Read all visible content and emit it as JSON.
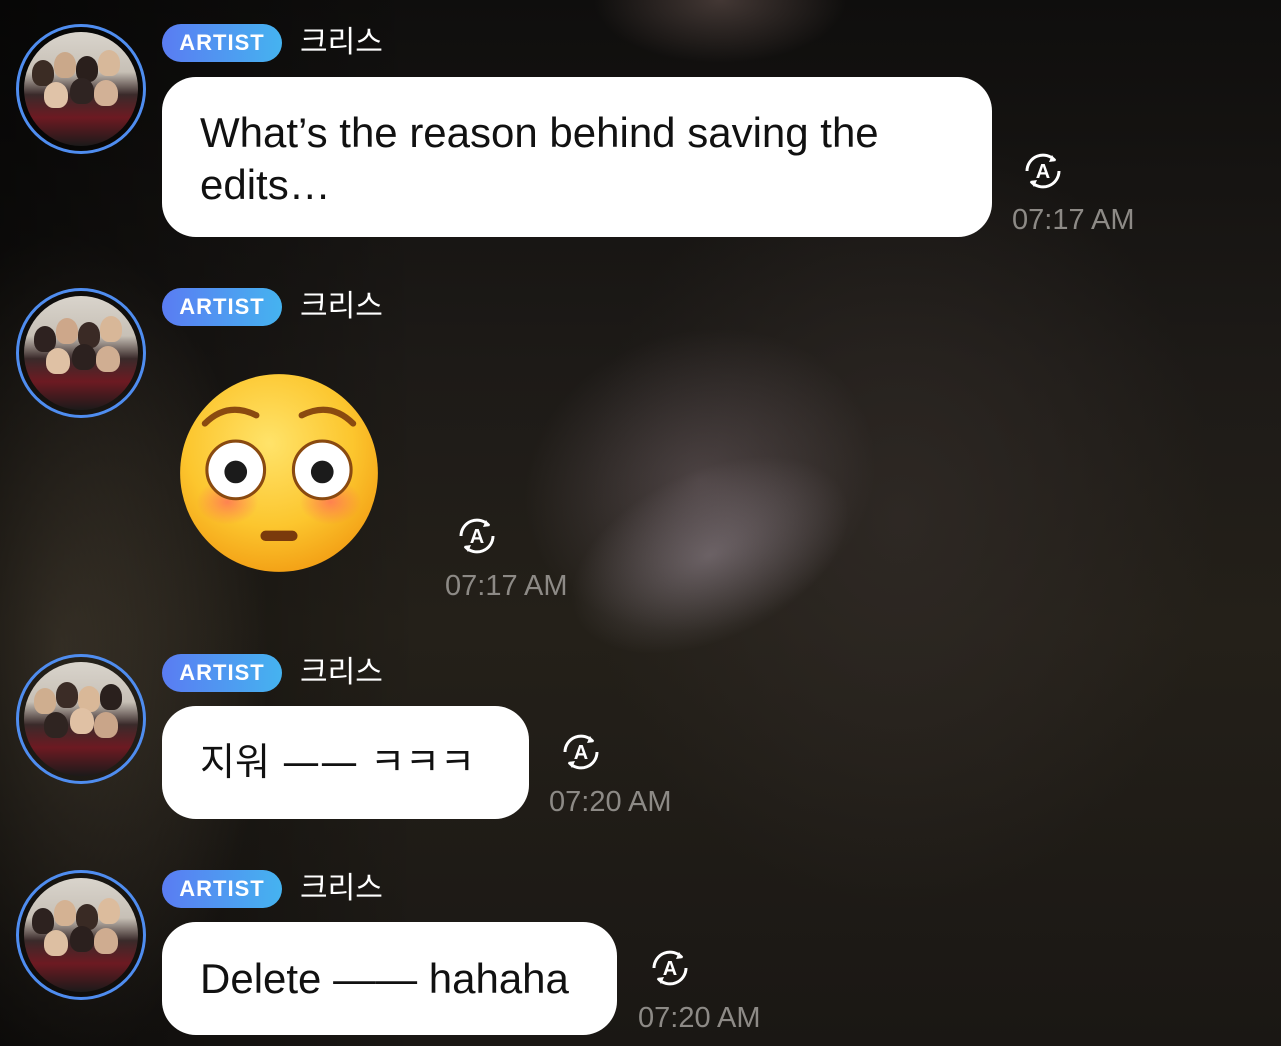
{
  "messages": [
    {
      "badge": "ARTIST",
      "sender": "크리스",
      "text": "What’s the reason behind saving the edits…",
      "time": "07:17 AM",
      "translate_icon": "translate-icon"
    },
    {
      "badge": "ARTIST",
      "sender": "크리스",
      "emoji": "flushed-face-emoji",
      "time": "07:17 AM",
      "translate_icon": "translate-icon"
    },
    {
      "badge": "ARTIST",
      "sender": "크리스",
      "text": "지워 —— ㅋㅋㅋ",
      "time": "07:20 AM",
      "translate_icon": "translate-icon"
    },
    {
      "badge": "ARTIST",
      "sender": "크리스",
      "text": "Delete —— hahaha",
      "time": "07:20 AM",
      "translate_icon": "translate-icon"
    }
  ],
  "colors": {
    "badge_gradient_start": "#5a7cf2",
    "badge_gradient_end": "#45b3f0",
    "avatar_ring": "#4f8df0",
    "bubble": "#ffffff",
    "timestamp": "#8d8a86"
  }
}
